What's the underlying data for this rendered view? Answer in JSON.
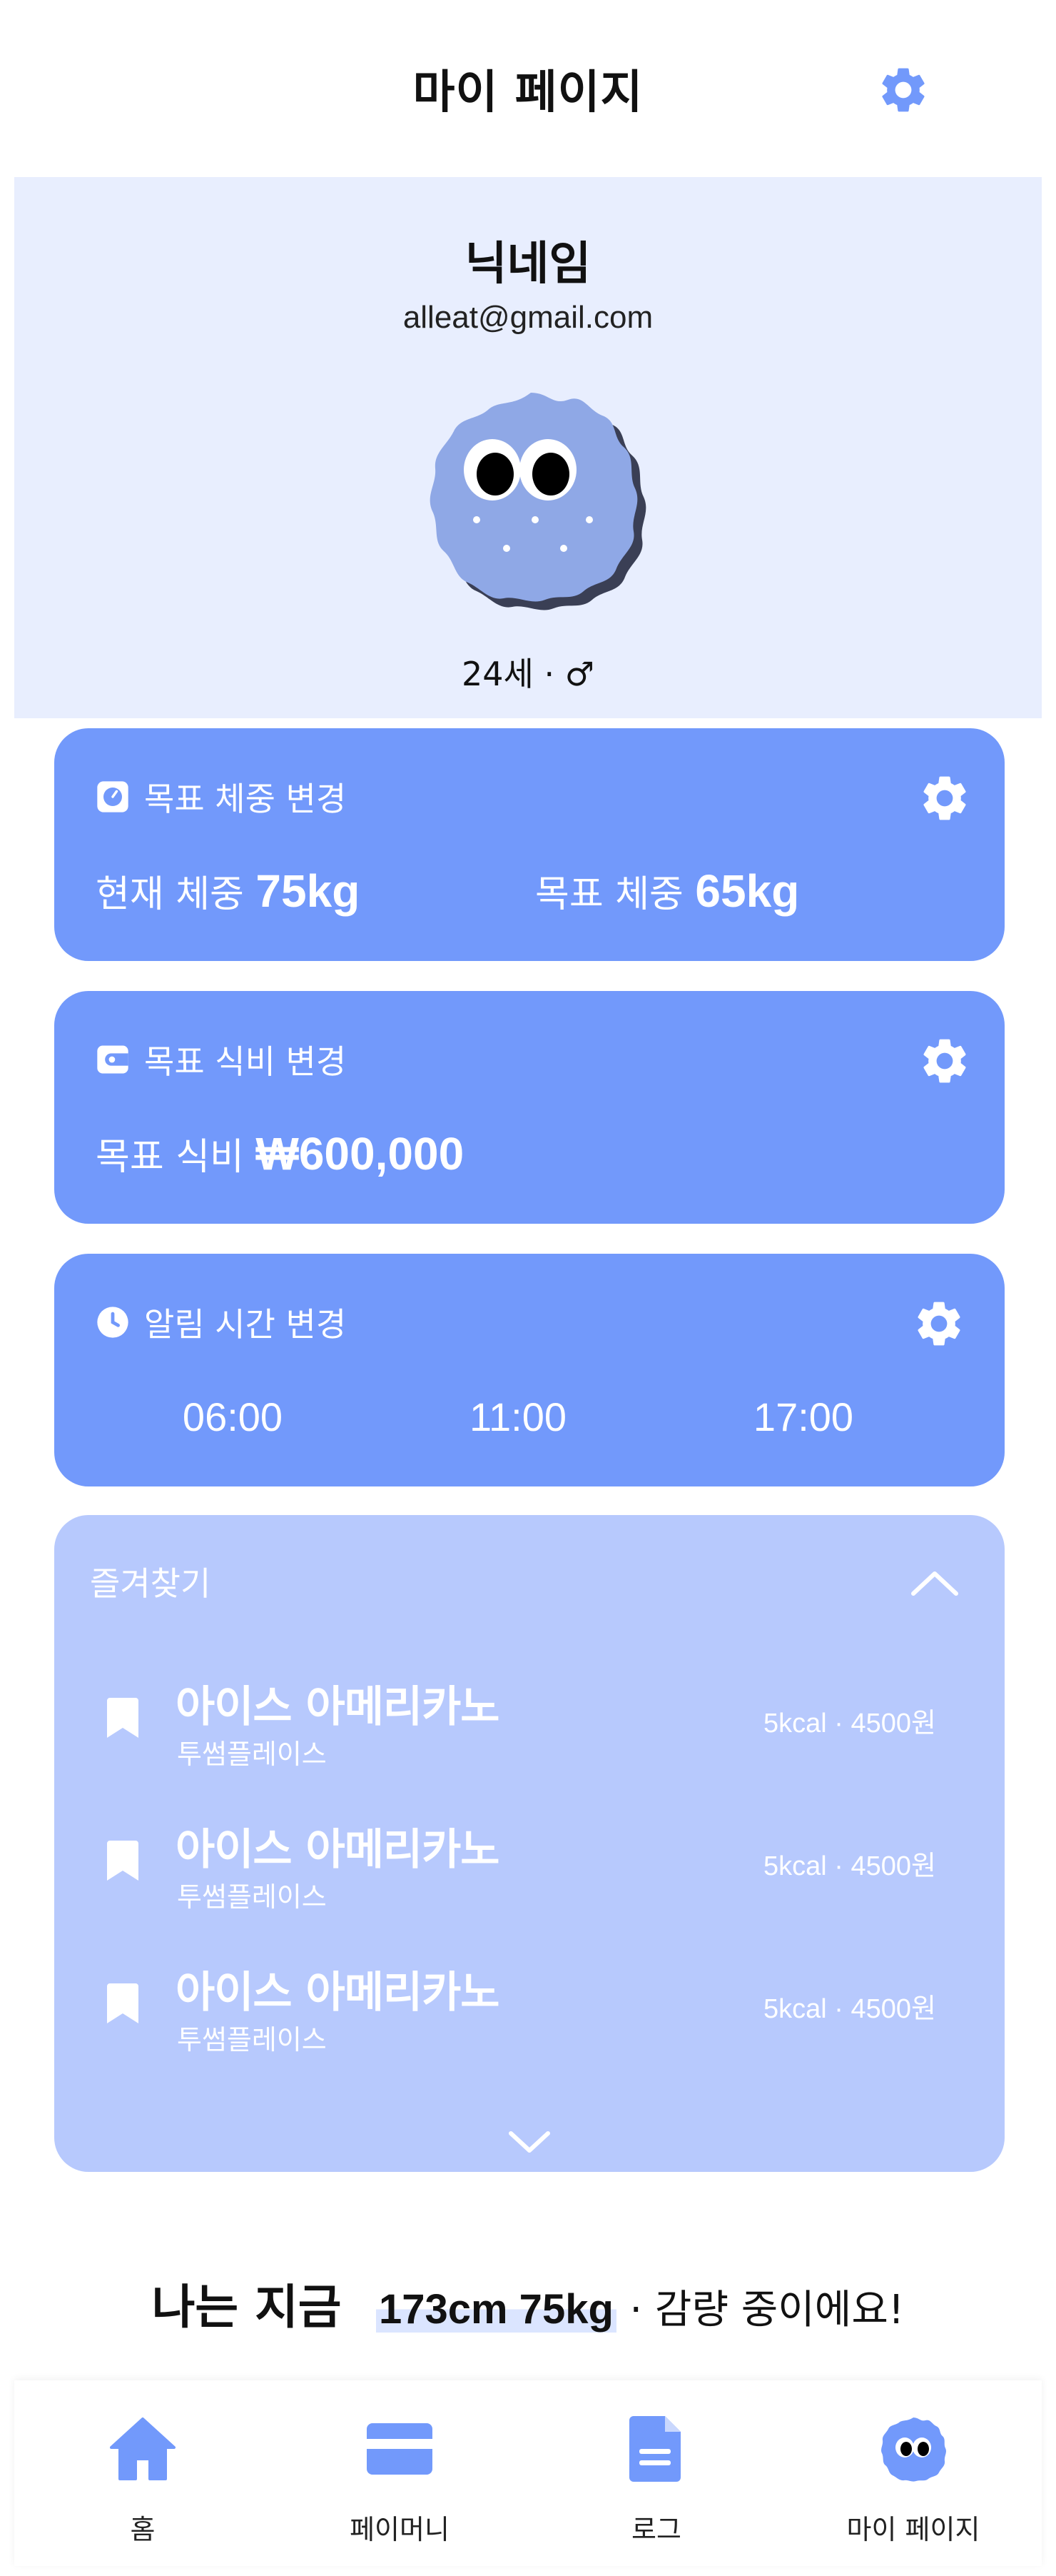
{
  "header": {
    "title": "마이 페이지"
  },
  "profile": {
    "nickname": "닉네임",
    "email": "alleat@gmail.com",
    "age": "24세",
    "separator": "·",
    "gender_symbol": "♂"
  },
  "weight_card": {
    "title": "목표 체중 변경",
    "current_label": "현재 체중",
    "current_value": "75kg",
    "target_label": "목표 체중",
    "target_value": "65kg"
  },
  "budget_card": {
    "title": "목표 식비 변경",
    "label": "목표 식비",
    "value": "₩600,000"
  },
  "alarm_card": {
    "title": "알림 시간 변경",
    "times": [
      "06:00",
      "11:00",
      "17:00"
    ]
  },
  "favorites": {
    "title": "즐겨찾기",
    "items": [
      {
        "name": "아이스 아메리카노",
        "place": "투썸플레이스",
        "meta": "5kcal · 4500원"
      },
      {
        "name": "아이스 아메리카노",
        "place": "투썸플레이스",
        "meta": "5kcal · 4500원"
      },
      {
        "name": "아이스 아메리카노",
        "place": "투썸플레이스",
        "meta": "5kcal · 4500원"
      }
    ]
  },
  "status": {
    "lead": "나는 지금",
    "highlight": "173cm 75kg",
    "tail": "· 감량 중이에요!"
  },
  "nav": {
    "items": [
      {
        "label": "홈",
        "icon": "home-icon"
      },
      {
        "label": "페이머니",
        "icon": "card-icon"
      },
      {
        "label": "로그",
        "icon": "document-icon"
      },
      {
        "label": "마이 페이지",
        "icon": "character-icon"
      }
    ]
  },
  "colors": {
    "accent": "#7299fb",
    "profile_bg": "#e8eefe",
    "favorites_bg": "#b7c9fd",
    "avatar": "#8fa8e6",
    "highlight": "#dbe5ff"
  }
}
